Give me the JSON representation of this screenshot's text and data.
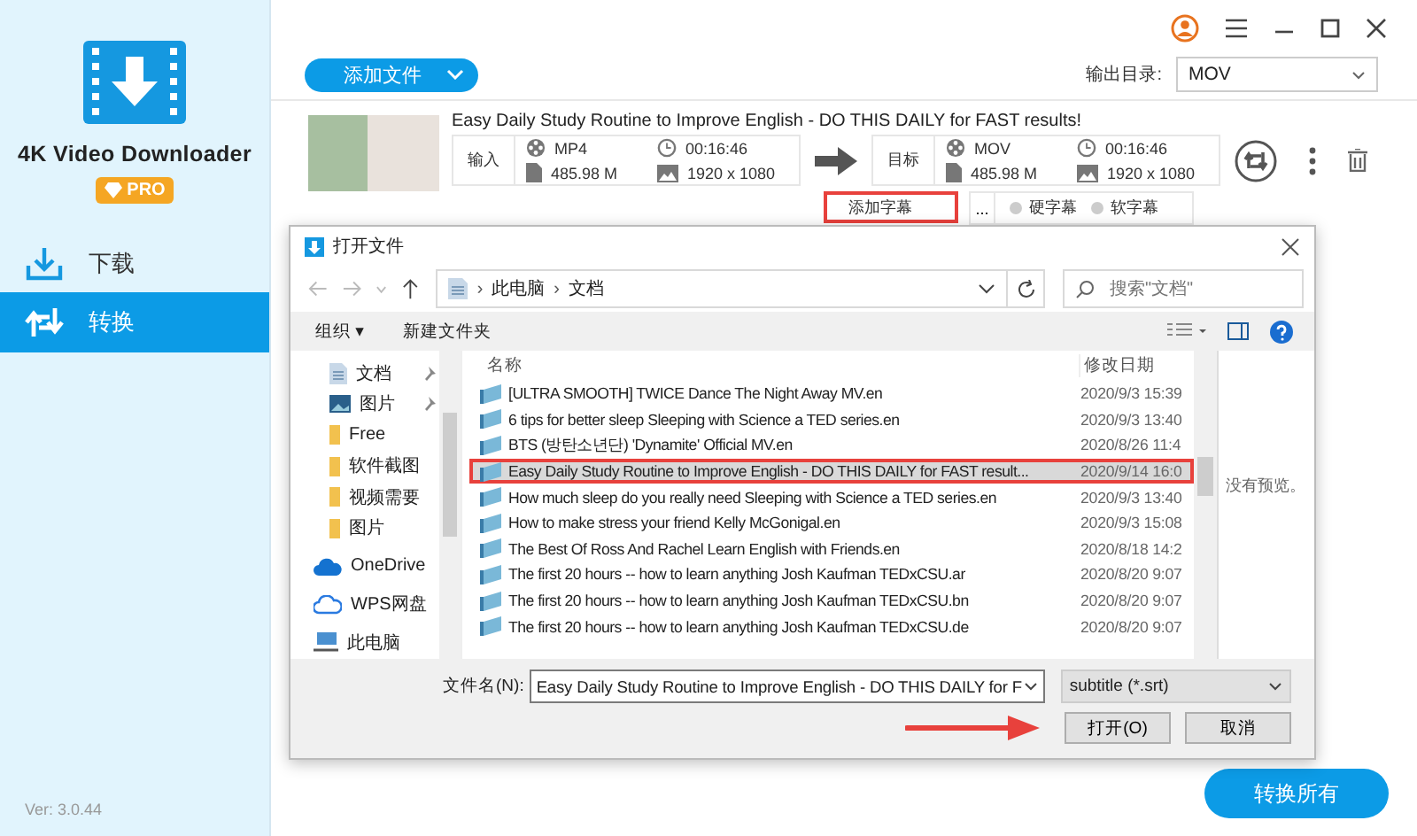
{
  "app": {
    "name": "4K Video Downloader",
    "badge": "PRO",
    "version": "Ver: 3.0.44"
  },
  "nav": [
    {
      "label": "下载",
      "selected": false
    },
    {
      "label": "转换",
      "selected": true
    }
  ],
  "toolbar": {
    "add_button": "添加文件",
    "output_label": "输出目录:",
    "output_format": "MOV"
  },
  "task": {
    "title": "Easy Daily Study Routine to Improve English - DO THIS DAILY for FAST results!",
    "input_label": "输入",
    "input": {
      "format": "MP4",
      "duration": "00:16:46",
      "size": "485.98 M",
      "resolution": "1920 x 1080"
    },
    "target_label": "目标",
    "target": {
      "format": "MOV",
      "duration": "00:16:46",
      "size": "485.98 M",
      "resolution": "1920 x 1080"
    },
    "subtitle_button": "添加字幕",
    "subtitle_highlighted": true,
    "more": "...",
    "subtitle_modes": [
      {
        "label": "硬字幕",
        "selected": false
      },
      {
        "label": "软字幕",
        "selected": false
      }
    ]
  },
  "dialog": {
    "title": "打开文件",
    "path_separator": "›",
    "path": [
      "此电脑",
      "文档"
    ],
    "search_placeholder": "搜索\"文档\"",
    "organize": "组织 ▾",
    "new_folder": "新建文件夹",
    "tree": [
      {
        "label": "文档",
        "kind": "document",
        "pinned": true
      },
      {
        "label": "图片",
        "kind": "pictures",
        "pinned": true
      },
      {
        "label": "Free",
        "kind": "folder",
        "pinned": false
      },
      {
        "label": "软件截图",
        "kind": "folder",
        "pinned": false
      },
      {
        "label": "视频需要",
        "kind": "folder",
        "pinned": false
      },
      {
        "label": "图片",
        "kind": "folder",
        "pinned": false
      },
      {
        "label": "OneDrive",
        "kind": "cloud",
        "pinned": false
      },
      {
        "label": "WPS网盘",
        "kind": "wps",
        "pinned": false
      },
      {
        "label": "此电脑",
        "kind": "computer",
        "pinned": false
      }
    ],
    "columns": [
      "名称",
      "修改日期"
    ],
    "files": [
      {
        "name": "[ULTRA SMOOTH] TWICE Dance The Night Away MV.en",
        "date": "2020/9/3 15:39",
        "selected": false,
        "highlighted": false
      },
      {
        "name": "6 tips for better sleep  Sleeping with Science a TED series.en",
        "date": "2020/9/3 13:40",
        "selected": false,
        "highlighted": false
      },
      {
        "name": "BTS (방탄소년단) 'Dynamite' Official MV.en",
        "date": "2020/8/26 11:4",
        "selected": false,
        "highlighted": false
      },
      {
        "name": "Easy Daily Study Routine to Improve English - DO THIS DAILY for FAST result...",
        "date": "2020/9/14 16:0",
        "selected": true,
        "highlighted": true
      },
      {
        "name": "How much sleep do you really need  Sleeping with Science a TED series.en",
        "date": "2020/9/3 13:40",
        "selected": false,
        "highlighted": false
      },
      {
        "name": "How to make stress your friend  Kelly McGonigal.en",
        "date": "2020/9/3 15:08",
        "selected": false,
        "highlighted": false
      },
      {
        "name": "The Best Of Ross And Rachel  Learn English with Friends.en",
        "date": "2020/8/18 14:2",
        "selected": false,
        "highlighted": false
      },
      {
        "name": "The first 20 hours -- how to learn anything  Josh Kaufman  TEDxCSU.ar",
        "date": "2020/8/20 9:07",
        "selected": false,
        "highlighted": false
      },
      {
        "name": "The first 20 hours -- how to learn anything  Josh Kaufman  TEDxCSU.bn",
        "date": "2020/8/20 9:07",
        "selected": false,
        "highlighted": false
      },
      {
        "name": "The first 20 hours -- how to learn anything  Josh Kaufman  TEDxCSU.de",
        "date": "2020/8/20 9:07",
        "selected": false,
        "highlighted": false
      }
    ],
    "preview": "没有预览。",
    "filename_label": "文件名(N):",
    "filename": "Easy Daily Study Routine to Improve English - DO THIS DAILY for F",
    "filetype": "subtitle (*.srt)",
    "open": "打开(O)",
    "cancel": "取消"
  },
  "convert_all": "转换所有"
}
